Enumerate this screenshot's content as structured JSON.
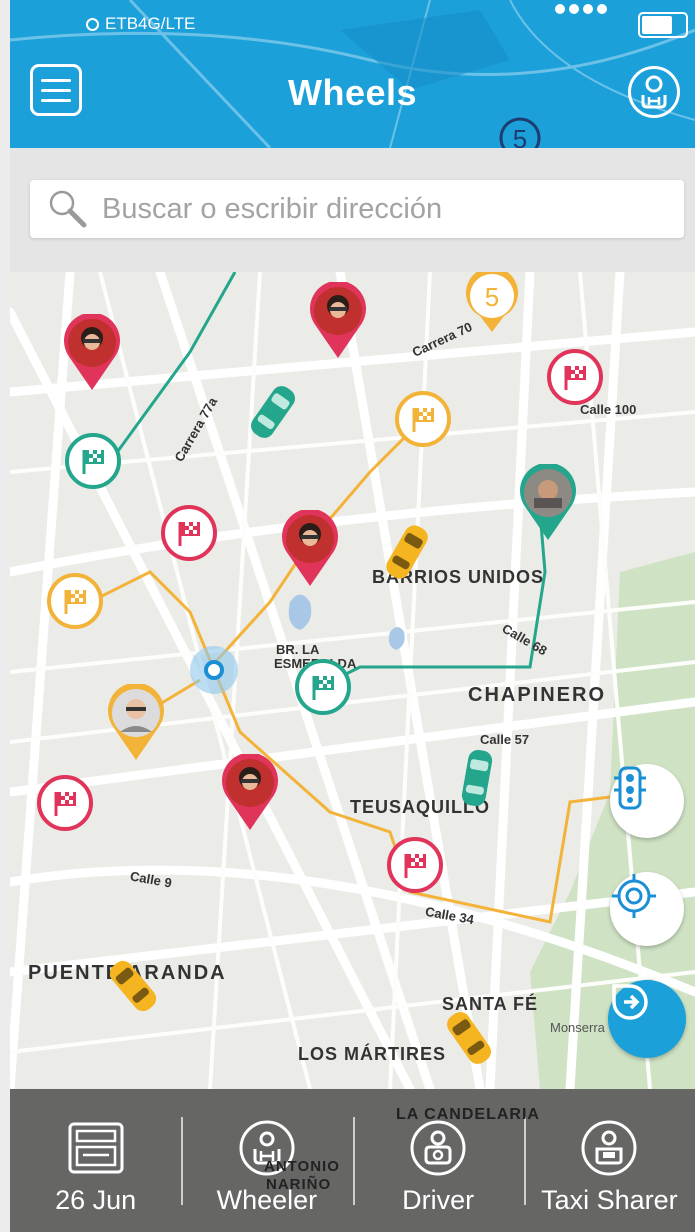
{
  "status_bar": {
    "carrier": "ETB4G/LTE"
  },
  "header": {
    "title": "Wheels"
  },
  "search": {
    "placeholder": "Buscar o escribir dirección"
  },
  "map": {
    "labels": {
      "barrios_unidos": "BARRIOS UNIDOS",
      "chapinero": "CHAPINERO",
      "teusaquillo": "TEUSAQUILLO",
      "puente_aranda": "PUENTE ARANDA",
      "santa_fe": "SANTA FÉ",
      "los_martires": "LOS MÁRTIRES",
      "la_candelaria": "LA CANDELARIA",
      "br_la_esmeralda_1": "BR. LA",
      "br_la_esmeralda_2": "ESMERALDA",
      "antonio_narino_1": "ANTONIO",
      "antonio_narino_2": "NARIÑO",
      "monserrate": "Monserra",
      "cluster_count": "5",
      "header_cluster_count": "5"
    },
    "colors": {
      "teal": "#23a68c",
      "orange": "#f3b339",
      "red": "#e0345a",
      "taxi": "#f4b521"
    }
  },
  "bottom_bar": {
    "tabs": [
      {
        "label": "26 Jun",
        "icon": "calendar-icon"
      },
      {
        "label": "Wheeler",
        "icon": "wheeler-icon"
      },
      {
        "label": "Driver",
        "icon": "driver-icon"
      },
      {
        "label": "Taxi Sharer",
        "icon": "taxi-sharer-icon"
      }
    ]
  }
}
